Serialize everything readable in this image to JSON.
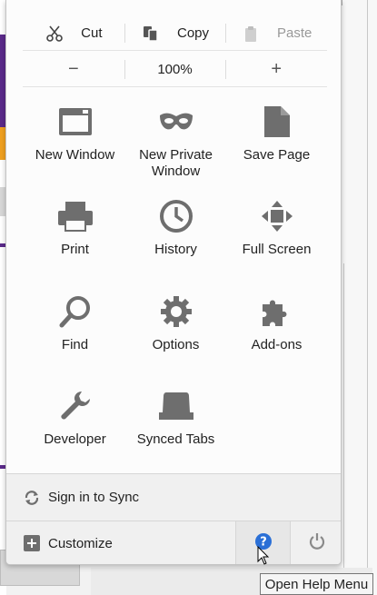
{
  "edit": {
    "cut_label": "Cut",
    "copy_label": "Copy",
    "paste_label": "Paste"
  },
  "zoom": {
    "minus_label": "−",
    "level": "100%",
    "plus_label": "+"
  },
  "tiles": [
    {
      "label": "New Window",
      "icon": "window-icon"
    },
    {
      "label": "New Private\nWindow",
      "icon": "private-mask-icon"
    },
    {
      "label": "Save Page",
      "icon": "document-icon"
    },
    {
      "label": "Print",
      "icon": "printer-icon"
    },
    {
      "label": "History",
      "icon": "clock-icon"
    },
    {
      "label": "Full Screen",
      "icon": "fullscreen-arrows-icon"
    },
    {
      "label": "Find",
      "icon": "magnifier-icon"
    },
    {
      "label": "Options",
      "icon": "gear-icon"
    },
    {
      "label": "Add-ons",
      "icon": "puzzle-icon"
    },
    {
      "label": "Developer",
      "icon": "wrench-icon"
    },
    {
      "label": "Synced Tabs",
      "icon": "synced-tab-icon"
    }
  ],
  "footer": {
    "sync_label": "Sign in to Sync",
    "customize_label": "Customize"
  },
  "tooltip": {
    "text": "Open Help Menu"
  },
  "colors": {
    "icon_gray": "#6e6e6e",
    "help_blue": "#2a6fd6",
    "purple_accent": "#5b2a8a",
    "orange_accent": "#f0a020"
  }
}
